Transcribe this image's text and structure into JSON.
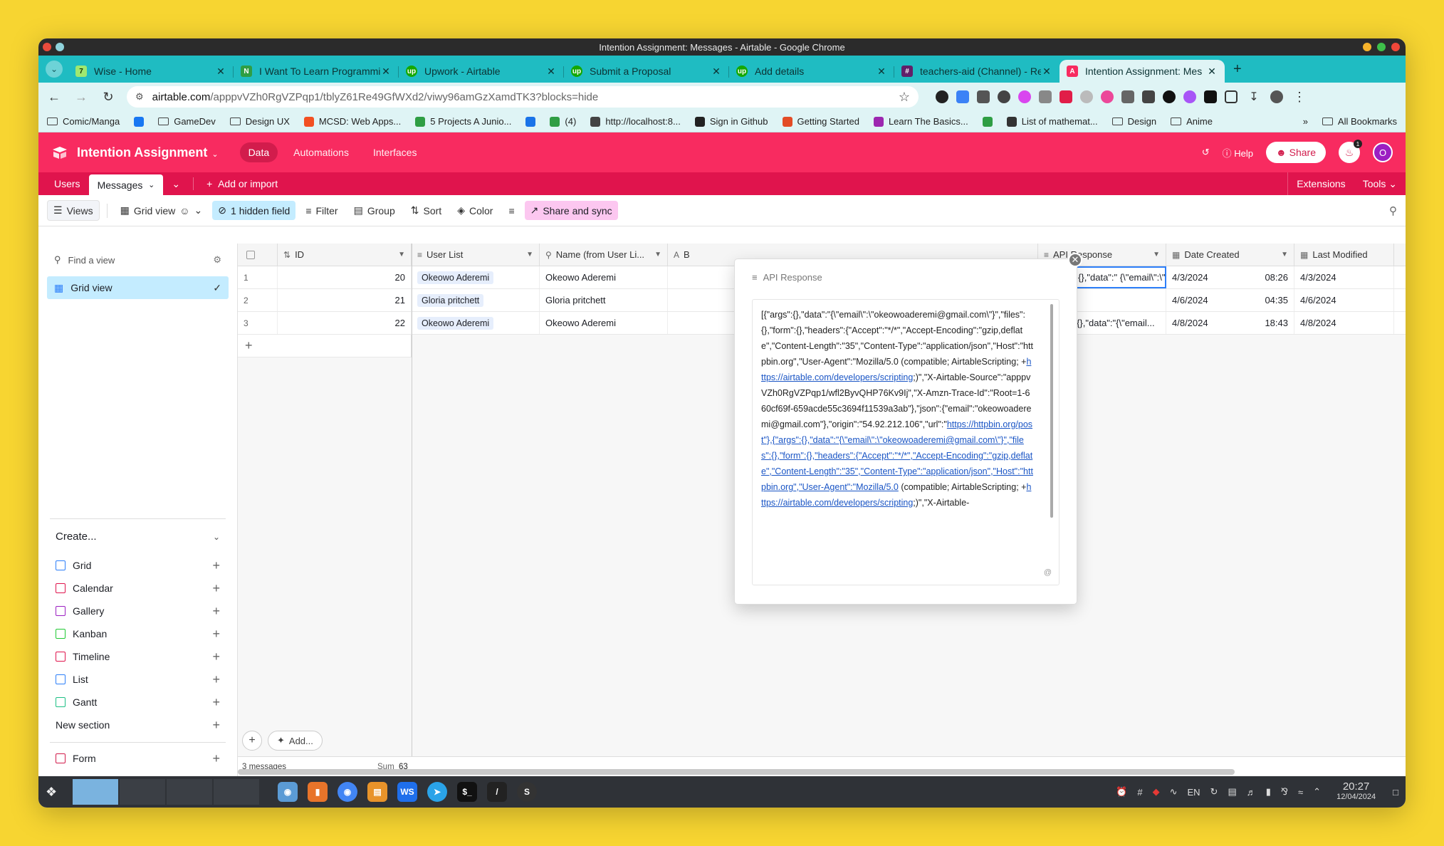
{
  "window": {
    "title": "Intention Assignment: Messages - Airtable - Google Chrome"
  },
  "tabs": [
    {
      "label": "Wise - Home",
      "fav": "#9fe870",
      "glyph": "7"
    },
    {
      "label": "I Want To Learn Programmin",
      "fav": "#2f9e44",
      "glyph": "N"
    },
    {
      "label": "Upwork - Airtable",
      "fav": "#14a800",
      "glyph": "up"
    },
    {
      "label": "Submit a Proposal",
      "fav": "#14a800",
      "glyph": "up"
    },
    {
      "label": "Add details",
      "fav": "#14a800",
      "glyph": "up"
    },
    {
      "label": "teachers-aid (Channel) - Re",
      "fav": "#611f69",
      "glyph": "#"
    },
    {
      "label": "Intention Assignment: Mes",
      "fav": "#f82b60",
      "glyph": "A"
    }
  ],
  "address": {
    "host": "airtable.com",
    "path": "/apppvVZh0RgVZPqp1/tblyZ61Re49GfWXd2/viwy96amGzXamdTK3?blocks=hide"
  },
  "bookmarks": [
    {
      "label": "Comic/Manga",
      "type": "folder"
    },
    {
      "label": "",
      "type": "icon",
      "color": "#1877f2"
    },
    {
      "label": "GameDev",
      "type": "folder"
    },
    {
      "label": "Design UX",
      "type": "folder"
    },
    {
      "label": "MCSD: Web Apps...",
      "type": "icon",
      "color": "#f25022"
    },
    {
      "label": "5 Projects A Junio...",
      "type": "icon",
      "color": "#2f9e44"
    },
    {
      "label": "",
      "type": "icon",
      "color": "#1a73e8"
    },
    {
      "label": "(4)",
      "type": "icon",
      "color": "#2f9e44"
    },
    {
      "label": "http://localhost:8...",
      "type": "icon",
      "color": "#444"
    },
    {
      "label": "Sign in Github",
      "type": "icon",
      "color": "#222"
    },
    {
      "label": "Getting Started",
      "type": "icon",
      "color": "#e34c26"
    },
    {
      "label": "Learn The Basics...",
      "type": "icon",
      "color": "#9c27b0"
    },
    {
      "label": "",
      "type": "icon",
      "color": "#2f9e44"
    },
    {
      "label": "List of mathemat...",
      "type": "icon",
      "color": "#333"
    },
    {
      "label": "Design",
      "type": "folder"
    },
    {
      "label": "Anime",
      "type": "folder"
    }
  ],
  "bookmarks_more": "»",
  "all_bookmarks": "All Bookmarks",
  "header": {
    "base_name": "Intention Assignment",
    "nav": [
      "Data",
      "Automations",
      "Interfaces"
    ],
    "help": "Help",
    "share": "Share",
    "avatar": "O",
    "badge": "1"
  },
  "table_tabs": {
    "items": [
      "Users",
      "Messages"
    ],
    "add": "Add or import",
    "extensions": "Extensions",
    "tools": "Tools"
  },
  "toolbar": {
    "views": "Views",
    "grid_view": "Grid view",
    "hidden": "1 hidden field",
    "filter": "Filter",
    "group": "Group",
    "sort": "Sort",
    "color": "Color",
    "share_sync": "Share and sync"
  },
  "sidebar": {
    "find_placeholder": "Find a view",
    "view_name": "Grid view",
    "create": "Create...",
    "create_items": [
      {
        "label": "Grid",
        "color": "#2d7ff9"
      },
      {
        "label": "Calendar",
        "color": "#e0144d"
      },
      {
        "label": "Gallery",
        "color": "#9c1fc2"
      },
      {
        "label": "Kanban",
        "color": "#20c933"
      },
      {
        "label": "Timeline",
        "color": "#e0144d"
      },
      {
        "label": "List",
        "color": "#2d7ff9"
      },
      {
        "label": "Gantt",
        "color": "#1dbf84"
      },
      {
        "label": "New section",
        "color": ""
      }
    ],
    "form": {
      "label": "Form",
      "color": "#d21c4c"
    }
  },
  "grid": {
    "columns": [
      "ID",
      "User List",
      "Name (from User Li...",
      "B",
      "API Response",
      "Date Created",
      "Last Modified"
    ],
    "rows": [
      {
        "n": "1",
        "id": "20",
        "user": "Okeowo Aderemi",
        "name": "Okeowo Aderemi",
        "api": "[{\"args\":{},\"data\":\" {\\\"email\\\":\\\"okeowoad...",
        "date": "4/3/2024",
        "time": "08:26",
        "modified": "4/3/2024"
      },
      {
        "n": "2",
        "id": "21",
        "user": "Gloria pritchett",
        "name": "Gloria pritchett",
        "api": "",
        "date": "4/6/2024",
        "time": "04:35",
        "modified": "4/6/2024"
      },
      {
        "n": "3",
        "id": "22",
        "user": "Okeowo Aderemi",
        "name": "Okeowo Aderemi",
        "api": "[{\"args\":{},\"data\":\"{\\\"email...",
        "date": "4/8/2024",
        "time": "18:43",
        "modified": "4/8/2024"
      }
    ],
    "footer_count": "3 messages",
    "sum_label": "Sum",
    "sum_value": "63",
    "add_label": "Add..."
  },
  "popup": {
    "title": "API Response",
    "text_a": "[{\"args\":{},\"data\":\"{\\\"email\\\":\\\"okeowoaderemi@gmail.com\\\"}\",\"files\":{},\"form\":{},\"headers\":{\"Accept\":\"*/*\",\"Accept-Encoding\":\"gzip,deflate\",\"Content-Length\":\"35\",\"Content-Type\":\"application/json\",\"Host\":\"httpbin.org\",\"User-Agent\":\"Mozilla/5.0 (compatible; AirtableScripting; +",
    "link_a": "https://airtable.com/developers/scripting",
    "text_b": ";)\",\"X-Airtable-Source\":\"apppvVZh0RgVZPqp1/wfl2ByvQHP76Kv9Ij\",\"X-Amzn-Trace-Id\":\"Root=1-660cf69f-659acde55c3694f11539a3ab\"},\"json\":{\"email\":\"okeowoaderemi@gmail.com\"},\"origin\":\"54.92.212.106\",\"url\":\"",
    "link_b": "https://httpbin.org/post\"},{\"args\":{},\"data\":\"{\\\"email\\\":\\\"okeowoaderemi@gmail.com\\\"}\",\"files\":{},\"form\":{},\"headers\":{\"Accept\":\"*/*\",\"Accept-Encoding\":\"gzip,deflate\",\"Content-Length\":\"35\",\"Content-Type\":\"application/json\",\"Host\":\"httpbin.org\",\"User-Agent\":\"Mozilla/5.0",
    "text_c": " (compatible; AirtableScripting; +",
    "link_c": "https://airtable.com/developers/scripting",
    "text_d": ";)\",\"X-Airtable-"
  },
  "taskbar": {
    "lang": "EN",
    "time": "20:27",
    "date": "12/04/2024"
  }
}
